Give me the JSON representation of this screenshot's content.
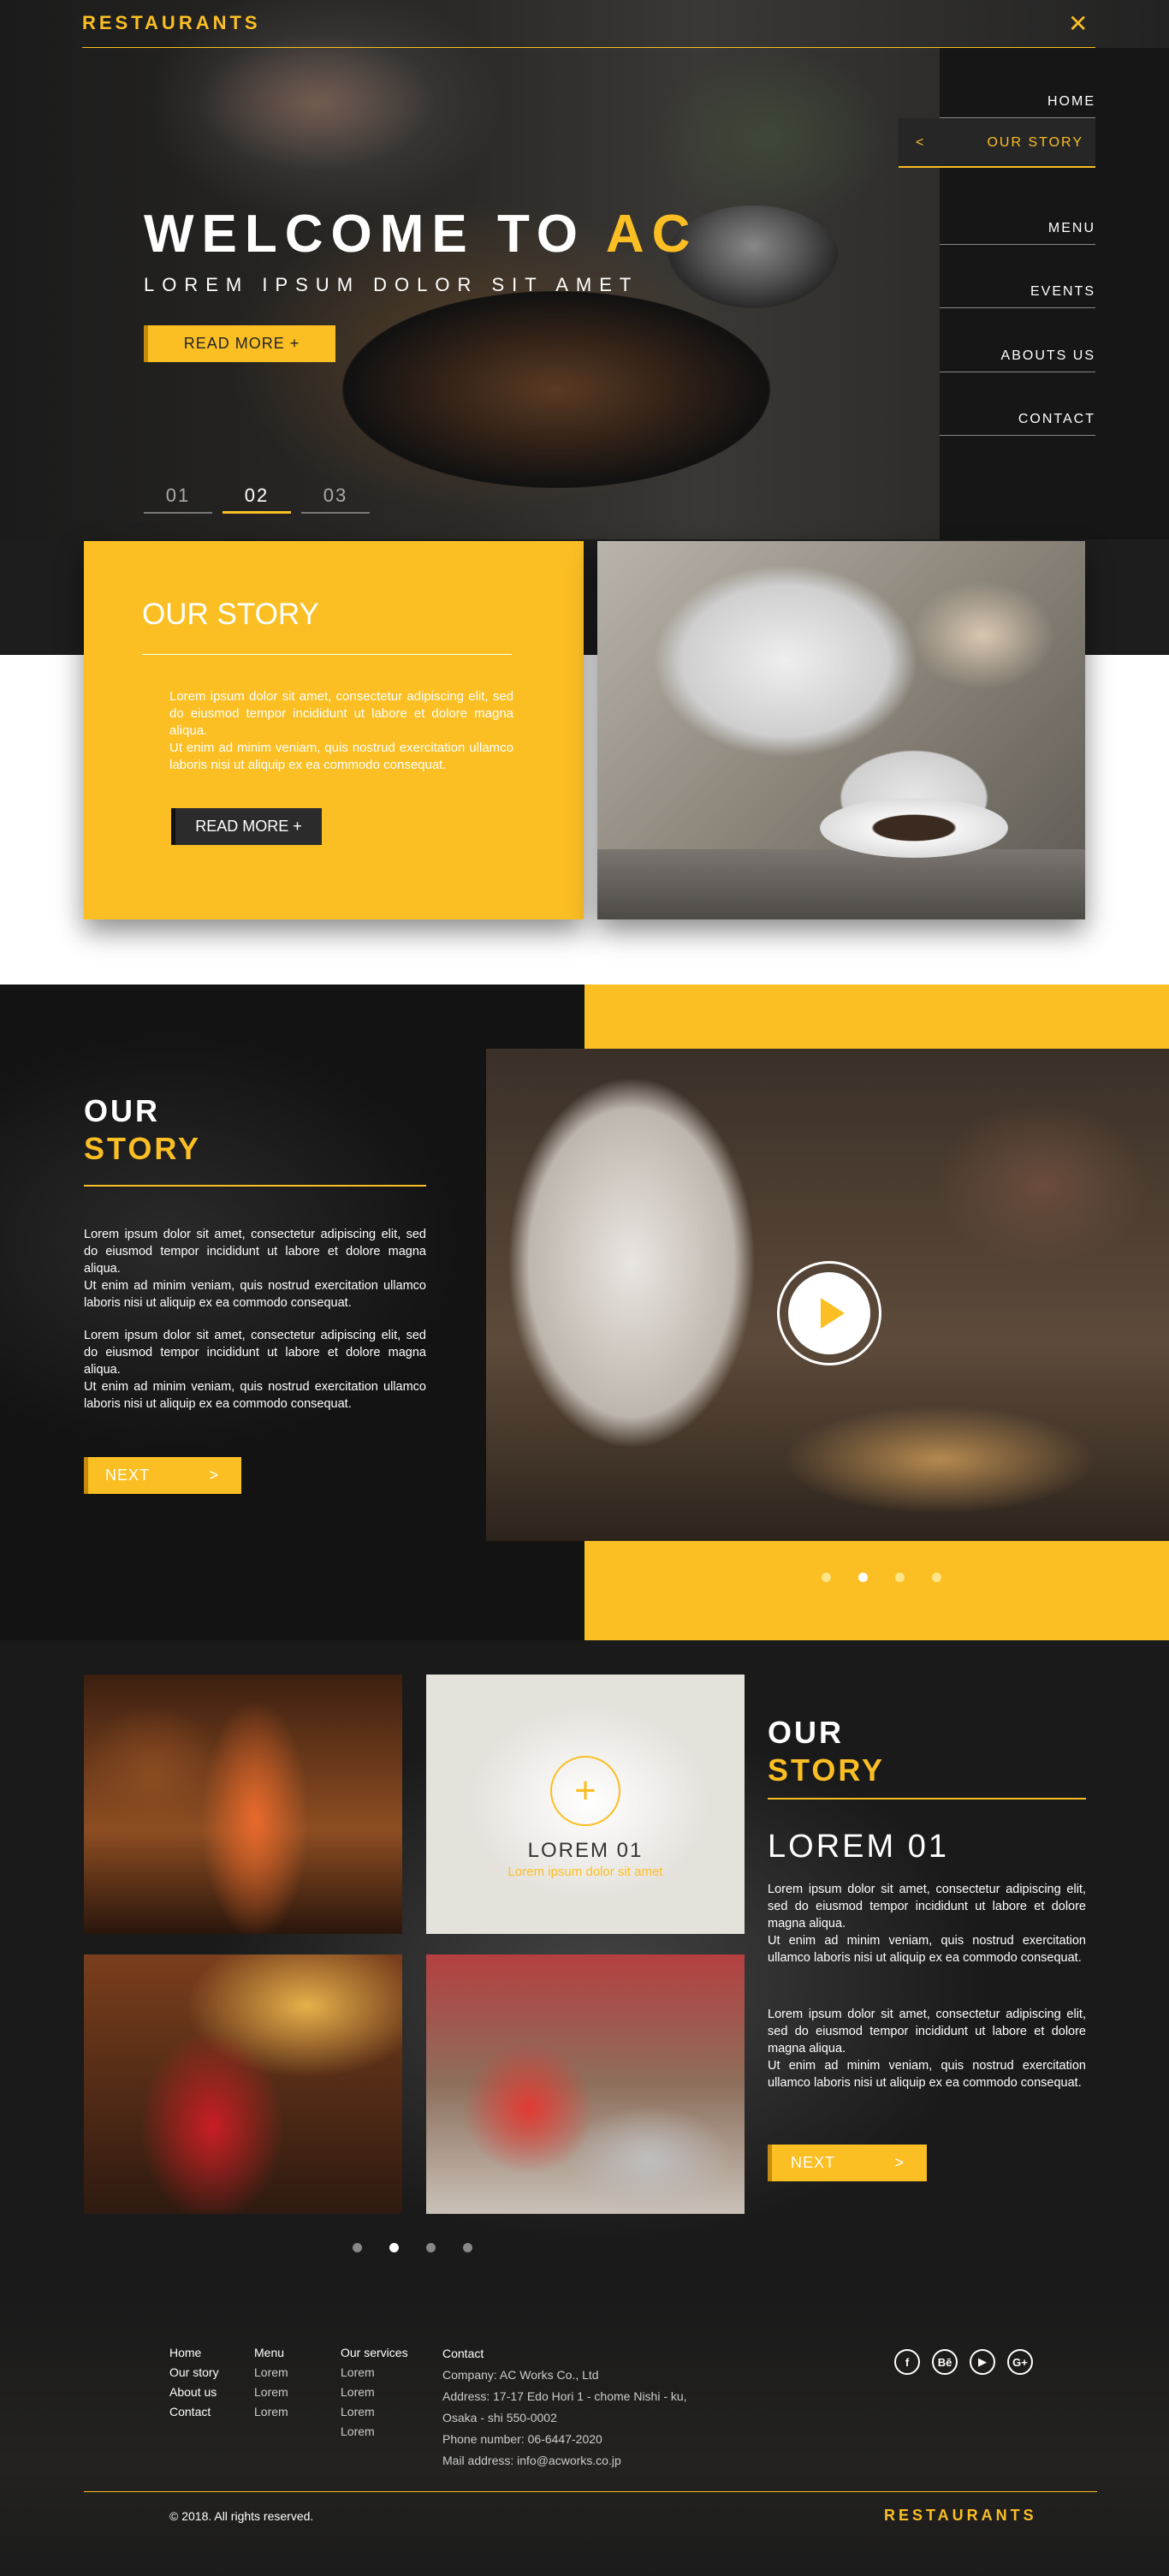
{
  "brand": "RESTAURANTS",
  "hero": {
    "title_white": "WELCOME TO ",
    "title_accent": "AC",
    "subtitle": "LOREM IPSUM DOLOR SIT AMET",
    "read_more": "READ MORE +",
    "slides": [
      "01",
      "02",
      "03"
    ],
    "active_slide": "02"
  },
  "nav": {
    "items": [
      "HOME",
      "OUR STORY",
      "MENU",
      "EVENTS",
      "ABOUTS US",
      "CONTACT"
    ],
    "active": "OUR STORY",
    "chevron": "<"
  },
  "story1": {
    "title": "OUR STORY",
    "text": "Lorem ipsum dolor sit amet, consectetur adipiscing elit, sed do eiusmod tempor incididunt ut labore et dolore magna aliqua.\nUt enim ad minim veniam, quis nostrud exercitation ullamco laboris nisi ut aliquip ex ea commodo consequat.",
    "button": "READ MORE   +"
  },
  "story2": {
    "title_line1": "OUR",
    "title_line2": "STORY",
    "paragraph1": "Lorem ipsum dolor sit amet, consectetur adipiscing elit, sed do eiusmod tempor incididunt ut labore et dolore magna aliqua.\nUt enim ad minim veniam, quis nostrud exercitation ullamco laboris nisi ut aliquip ex ea commodo consequat.",
    "paragraph2": "Lorem ipsum dolor sit amet, consectetur adipiscing elit, sed do eiusmod tempor incididunt ut labore et dolore magna aliqua.\nUt enim ad minim veniam, quis nostrud exercitation ullamco laboris nisi ut aliquip ex ea commodo consequat.",
    "next": "NEXT",
    "next_arrow": ">",
    "active_dot": 1
  },
  "story3": {
    "title_line1": "OUR",
    "title_line2": "STORY",
    "heading": "LOREM 01",
    "tile_caption": "LOREM 01",
    "tile_sub": "Lorem ipsum dolor sit amet",
    "tile_plus": "+",
    "paragraph1": "Lorem ipsum dolor sit amet, consectetur adipiscing elit, sed do eiusmod tempor incididunt ut labore et dolore magna aliqua.\nUt enim ad minim veniam, quis nostrud exercitation ullamco laboris nisi ut aliquip ex ea commodo consequat.",
    "paragraph2": "Lorem ipsum dolor sit amet, consectetur adipiscing elit, sed do eiusmod tempor incididunt ut labore et dolore magna aliqua.\nUt enim ad minim veniam, quis nostrud exercitation ullamco laboris nisi ut aliquip ex ea commodo consequat.",
    "next": "NEXT",
    "next_arrow": ">",
    "active_dot": 1
  },
  "footer": {
    "col1": [
      "Home",
      "Our story",
      "About us",
      "Contact"
    ],
    "col2_head": "Menu",
    "col2": [
      "Lorem",
      "Lorem",
      "Lorem"
    ],
    "col3_head": "Our services",
    "col3": [
      "Lorem",
      "Lorem",
      "Lorem",
      "Lorem"
    ],
    "contact_head": "Contact",
    "company": "Company: AC Works Co., Ltd",
    "address1": "Address: 17-17 Edo Hori 1 - chome Nishi - ku,",
    "address2": "Osaka - shi 550-0002",
    "phone": "Phone number: 06-6447-2020",
    "mail": "Mail address: info@acworks.co.jp",
    "copyright": "© 2018. All rights reserved.",
    "social_icons": [
      "facebook-icon",
      "behance-icon",
      "youtube-icon",
      "google-plus-icon"
    ]
  },
  "colors": {
    "accent": "#fbbf24",
    "dark": "#1d1d1d"
  }
}
